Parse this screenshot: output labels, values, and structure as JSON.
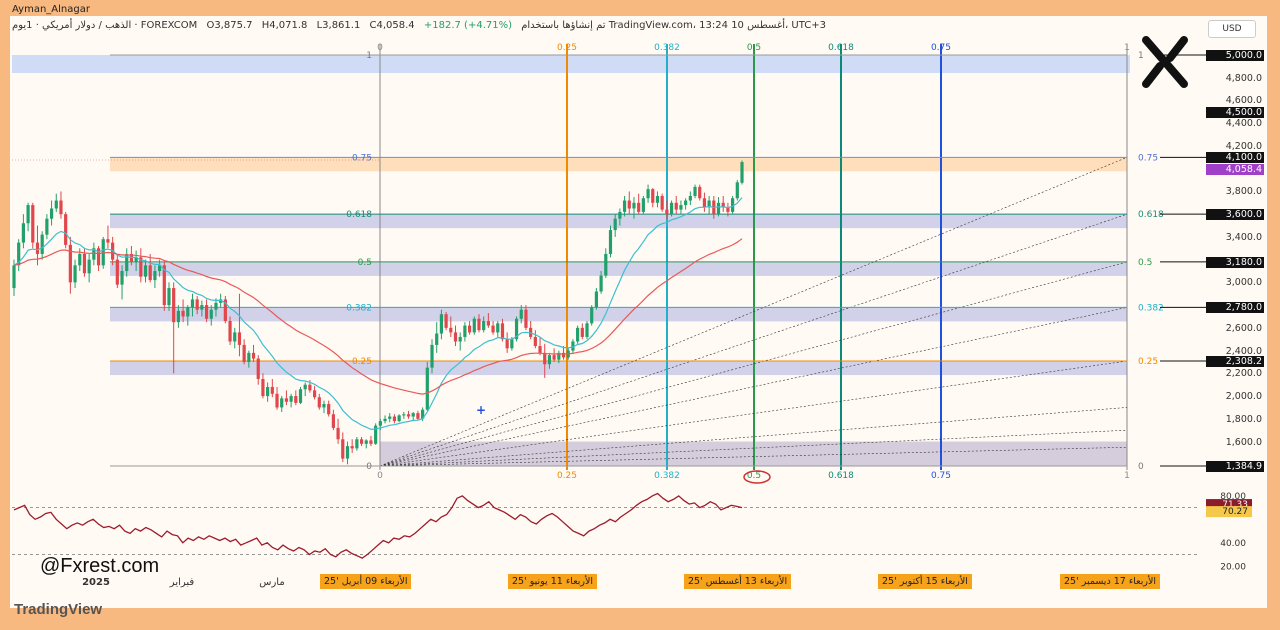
{
  "header": {
    "author": "Ayman_Alnagar",
    "published_text": "تم إنشاؤها باستخدام TradingView.com، 13:24 أغسطس 10، UTC+3",
    "symbol": "الذهب / دولار أمريكي · 1يوم · FOREXCOM",
    "open": "O3,875.7",
    "high": "H4,071.8",
    "low": "L3,861.1",
    "close": "C4,058.4",
    "change": "+182.7 (+4.71%)",
    "currency": "USD"
  },
  "watermark": "@Fxrest.com",
  "logo_text": "TradingView",
  "colors": {
    "up": "#22a06b",
    "down": "#e0464c",
    "ema_fast": "#3cc0d0",
    "ema_slow": "#e85a5a",
    "rsi": "#9c1c2c"
  },
  "chart_data": {
    "type": "candlestick",
    "instrument": "Gold / US Dollar",
    "ylim": [
      1200,
      5200
    ],
    "price_ticks": [
      1600,
      1800,
      2000,
      2200,
      2400,
      2600,
      2800,
      3000,
      3200,
      3400,
      3600,
      3800,
      4000,
      4200,
      4400,
      4600,
      4800
    ],
    "price_ticks_text": [
      "1,600.0",
      "1,800.0",
      "2,000.0",
      "2,200.0",
      "2,400.0",
      "2,600.0",
      "2,800.0",
      "3,000.0",
      "3,200.0",
      "3,400.0",
      "3,600.0",
      "3,800.0",
      "4,000.0",
      "4,200.0",
      "4,400.0",
      "4,600.0",
      "4,800.0"
    ],
    "marked_levels": [
      {
        "value": 5000.0,
        "text": "5,000.0"
      },
      {
        "value": 4500.0,
        "text": "4,500.0"
      },
      {
        "value": 4100.0,
        "text": "4,100.0"
      },
      {
        "value": 3600.0,
        "text": "3,600.0"
      },
      {
        "value": 3180.0,
        "text": "3,180.0"
      },
      {
        "value": 2780.0,
        "text": "2,780.0"
      },
      {
        "value": 2308.2,
        "text": "2,308.2"
      },
      {
        "value": 1384.9,
        "text": "1,384.9"
      }
    ],
    "last_price": {
      "value": 4058.4,
      "text": "4,058.4"
    },
    "fib_levels": [
      {
        "ratio": "0",
        "price": 1384.9
      },
      {
        "ratio": "0.25",
        "price": 2308.2
      },
      {
        "ratio": "0.382",
        "price": 2780.0
      },
      {
        "ratio": "0.5",
        "price": 3180.0
      },
      {
        "ratio": "0.618",
        "price": 3600.0
      },
      {
        "ratio": "0.75",
        "price": 4100.0
      },
      {
        "ratio": "1",
        "price": 5000.0
      }
    ],
    "time_fib_labels": [
      "0",
      "0.25",
      "0.382",
      "0.5",
      "0.618",
      "0.75",
      "1"
    ],
    "right_fib_labels": [
      "0",
      "0.25",
      "0.382",
      "0.5",
      "0.618",
      "0.75",
      "1"
    ],
    "x_axis_labels": [
      "2025",
      "فبراير",
      "مارس",
      "أبريل",
      "يونيو"
    ],
    "date_labels": [
      "الأربعاء 09 أبريل '25",
      "الأربعاء 11 يونيو '25",
      "الأربعاء 13 أغسطس '25",
      "الأربعاء 15 أكتوبر '25",
      "الأربعاء 17 ديسمبر '25"
    ],
    "candles": [
      [
        2950,
        3200,
        2880,
        3150
      ],
      [
        3150,
        3380,
        3100,
        3350
      ],
      [
        3350,
        3600,
        3300,
        3520
      ],
      [
        3520,
        3700,
        3450,
        3680
      ],
      [
        3680,
        3700,
        3300,
        3350
      ],
      [
        3350,
        3500,
        3150,
        3250
      ],
      [
        3250,
        3450,
        3200,
        3420
      ],
      [
        3420,
        3600,
        3380,
        3560
      ],
      [
        3560,
        3720,
        3500,
        3650
      ],
      [
        3650,
        3780,
        3620,
        3720
      ],
      [
        3720,
        3800,
        3560,
        3600
      ],
      [
        3600,
        3620,
        3300,
        3330
      ],
      [
        3330,
        3400,
        2900,
        3000
      ],
      [
        3000,
        3200,
        2950,
        3150
      ],
      [
        3150,
        3300,
        3100,
        3250
      ],
      [
        3250,
        3300,
        3050,
        3080
      ],
      [
        3080,
        3250,
        3000,
        3200
      ],
      [
        3200,
        3350,
        3150,
        3300
      ],
      [
        3300,
        3320,
        3100,
        3150
      ],
      [
        3150,
        3400,
        3120,
        3380
      ],
      [
        3380,
        3500,
        3300,
        3350
      ],
      [
        3350,
        3400,
        3150,
        3200
      ],
      [
        3200,
        3250,
        2950,
        2980
      ],
      [
        2980,
        3150,
        2850,
        3100
      ],
      [
        3100,
        3300,
        3050,
        3250
      ],
      [
        3250,
        3320,
        3150,
        3180
      ],
      [
        3180,
        3280,
        3100,
        3220
      ],
      [
        3220,
        3300,
        3000,
        3050
      ],
      [
        3050,
        3200,
        3000,
        3150
      ],
      [
        3150,
        3250,
        3000,
        3020
      ],
      [
        3020,
        3150,
        2950,
        3100
      ],
      [
        3100,
        3200,
        3050,
        3150
      ],
      [
        3150,
        3180,
        2750,
        2800
      ],
      [
        2800,
        3000,
        2750,
        2950
      ],
      [
        2950,
        3000,
        2200,
        2650
      ],
      [
        2650,
        2800,
        2600,
        2750
      ],
      [
        2750,
        2850,
        2650,
        2700
      ],
      [
        2700,
        2800,
        2620,
        2780
      ],
      [
        2780,
        2900,
        2700,
        2850
      ],
      [
        2850,
        2880,
        2720,
        2760
      ],
      [
        2760,
        2840,
        2700,
        2800
      ],
      [
        2800,
        2850,
        2650,
        2680
      ],
      [
        2680,
        2800,
        2620,
        2760
      ],
      [
        2760,
        2860,
        2700,
        2820
      ],
      [
        2820,
        2900,
        2780,
        2850
      ],
      [
        2850,
        2880,
        2640,
        2660
      ],
      [
        2660,
        2700,
        2450,
        2480
      ],
      [
        2480,
        2600,
        2420,
        2560
      ],
      [
        2560,
        2900,
        2350,
        2450
      ],
      [
        2450,
        2500,
        2280,
        2300
      ],
      [
        2300,
        2400,
        2250,
        2380
      ],
      [
        2380,
        2450,
        2300,
        2330
      ],
      [
        2330,
        2360,
        2100,
        2150
      ],
      [
        2150,
        2200,
        1980,
        2000
      ],
      [
        2000,
        2120,
        1950,
        2080
      ],
      [
        2080,
        2150,
        1990,
        2020
      ],
      [
        2020,
        2080,
        1880,
        1900
      ],
      [
        1900,
        2000,
        1860,
        1980
      ],
      [
        1980,
        2050,
        1920,
        1950
      ],
      [
        1950,
        2020,
        1900,
        2000
      ],
      [
        2000,
        2050,
        1920,
        1940
      ],
      [
        1940,
        2080,
        1930,
        2060
      ],
      [
        2060,
        2120,
        2000,
        2100
      ],
      [
        2100,
        2140,
        2030,
        2050
      ],
      [
        2050,
        2090,
        1970,
        1990
      ],
      [
        1990,
        2020,
        1880,
        1900
      ],
      [
        1900,
        1960,
        1850,
        1930
      ],
      [
        1930,
        1960,
        1820,
        1840
      ],
      [
        1840,
        1880,
        1700,
        1720
      ],
      [
        1720,
        1800,
        1580,
        1620
      ],
      [
        1620,
        1680,
        1420,
        1450
      ],
      [
        1450,
        1600,
        1400,
        1560
      ],
      [
        1560,
        1620,
        1500,
        1540
      ],
      [
        1540,
        1640,
        1520,
        1620
      ],
      [
        1620,
        1640,
        1560,
        1580
      ],
      [
        1580,
        1620,
        1540,
        1610
      ],
      [
        1610,
        1650,
        1560,
        1580
      ],
      [
        1580,
        1760,
        1570,
        1740
      ],
      [
        1740,
        1800,
        1700,
        1780
      ],
      [
        1780,
        1830,
        1760,
        1800
      ],
      [
        1800,
        1850,
        1770,
        1820
      ],
      [
        1820,
        1840,
        1760,
        1780
      ],
      [
        1780,
        1840,
        1770,
        1830
      ],
      [
        1830,
        1860,
        1800,
        1840
      ],
      [
        1840,
        1870,
        1800,
        1820
      ],
      [
        1820,
        1860,
        1780,
        1850
      ],
      [
        1850,
        1870,
        1790,
        1800
      ],
      [
        1800,
        1900,
        1780,
        1880
      ],
      [
        1880,
        2300,
        1870,
        2250
      ],
      [
        2250,
        2500,
        2200,
        2450
      ],
      [
        2450,
        2650,
        2380,
        2550
      ],
      [
        2550,
        2760,
        2500,
        2720
      ],
      [
        2720,
        2740,
        2580,
        2600
      ],
      [
        2600,
        2700,
        2520,
        2560
      ],
      [
        2560,
        2620,
        2440,
        2480
      ],
      [
        2480,
        2560,
        2400,
        2520
      ],
      [
        2520,
        2650,
        2480,
        2620
      ],
      [
        2620,
        2660,
        2540,
        2560
      ],
      [
        2560,
        2700,
        2540,
        2680
      ],
      [
        2680,
        2720,
        2560,
        2580
      ],
      [
        2580,
        2700,
        2560,
        2660
      ],
      [
        2660,
        2730,
        2600,
        2620
      ],
      [
        2620,
        2660,
        2540,
        2560
      ],
      [
        2560,
        2660,
        2520,
        2640
      ],
      [
        2640,
        2680,
        2480,
        2500
      ],
      [
        2500,
        2560,
        2380,
        2420
      ],
      [
        2420,
        2520,
        2400,
        2500
      ],
      [
        2500,
        2700,
        2480,
        2680
      ],
      [
        2680,
        2800,
        2640,
        2760
      ],
      [
        2760,
        2800,
        2580,
        2600
      ],
      [
        2600,
        2660,
        2500,
        2520
      ],
      [
        2520,
        2580,
        2420,
        2440
      ],
      [
        2440,
        2520,
        2360,
        2380
      ],
      [
        2380,
        2460,
        2160,
        2280
      ],
      [
        2280,
        2380,
        2240,
        2360
      ],
      [
        2360,
        2420,
        2300,
        2320
      ],
      [
        2320,
        2400,
        2290,
        2380
      ],
      [
        2380,
        2440,
        2320,
        2340
      ],
      [
        2340,
        2420,
        2320,
        2400
      ],
      [
        2400,
        2500,
        2380,
        2480
      ],
      [
        2480,
        2620,
        2460,
        2600
      ],
      [
        2600,
        2640,
        2500,
        2520
      ],
      [
        2520,
        2660,
        2500,
        2640
      ],
      [
        2640,
        2800,
        2620,
        2780
      ],
      [
        2780,
        2950,
        2760,
        2920
      ],
      [
        2920,
        3100,
        2900,
        3060
      ],
      [
        3060,
        3300,
        3040,
        3250
      ],
      [
        3250,
        3500,
        3220,
        3460
      ],
      [
        3460,
        3600,
        3400,
        3560
      ],
      [
        3560,
        3650,
        3500,
        3620
      ],
      [
        3620,
        3760,
        3580,
        3720
      ],
      [
        3720,
        3800,
        3600,
        3650
      ],
      [
        3650,
        3750,
        3560,
        3700
      ],
      [
        3700,
        3780,
        3600,
        3620
      ],
      [
        3620,
        3760,
        3600,
        3740
      ],
      [
        3740,
        3860,
        3700,
        3820
      ],
      [
        3820,
        3830,
        3660,
        3700
      ],
      [
        3700,
        3800,
        3660,
        3760
      ],
      [
        3760,
        3780,
        3620,
        3640
      ],
      [
        3640,
        3720,
        3560,
        3600
      ],
      [
        3600,
        3720,
        3580,
        3700
      ],
      [
        3700,
        3760,
        3600,
        3640
      ],
      [
        3640,
        3720,
        3600,
        3680
      ],
      [
        3680,
        3740,
        3640,
        3720
      ],
      [
        3720,
        3800,
        3680,
        3760
      ],
      [
        3760,
        3860,
        3740,
        3840
      ],
      [
        3840,
        3860,
        3720,
        3740
      ],
      [
        3740,
        3790,
        3620,
        3660
      ],
      [
        3660,
        3760,
        3600,
        3720
      ],
      [
        3720,
        3760,
        3560,
        3600
      ],
      [
        3600,
        3750,
        3580,
        3700
      ],
      [
        3700,
        3760,
        3620,
        3660
      ],
      [
        3660,
        3700,
        3580,
        3620
      ],
      [
        3620,
        3760,
        3600,
        3740
      ],
      [
        3740,
        3900,
        3720,
        3880
      ],
      [
        3876,
        4072,
        3861,
        4058
      ]
    ],
    "rsi": {
      "last_values": [
        "71.33",
        "70.27"
      ],
      "ticks": [
        "80.00",
        "40.00",
        "20.00"
      ],
      "levels": [
        70,
        30
      ],
      "values": [
        68,
        70,
        72,
        64,
        60,
        62,
        65,
        66,
        60,
        56,
        52,
        55,
        57,
        55,
        58,
        60,
        56,
        53,
        54,
        52,
        55,
        50,
        48,
        52,
        50,
        53,
        51,
        48,
        45,
        50,
        47,
        46,
        40,
        44,
        42,
        45,
        43,
        46,
        44,
        42,
        44,
        41,
        43,
        38,
        40,
        42,
        44,
        38,
        40,
        36,
        34,
        38,
        35,
        33,
        36,
        34,
        30,
        33,
        32,
        35,
        30,
        28,
        32,
        34,
        31,
        29,
        27,
        30,
        34,
        38,
        42,
        40,
        44,
        43,
        46,
        45,
        48,
        52,
        56,
        60,
        58,
        62,
        64,
        70,
        78,
        80,
        76,
        73,
        70,
        72,
        75,
        70,
        68,
        66,
        63,
        60,
        64,
        62,
        58,
        56,
        60,
        63,
        65,
        62,
        58,
        54,
        50,
        48,
        46,
        50,
        52,
        55,
        57,
        60,
        58,
        62,
        65,
        68,
        72,
        75,
        77,
        80,
        82,
        78,
        75,
        77,
        80,
        76,
        73,
        74,
        70,
        72,
        75,
        73,
        68,
        70,
        72,
        71,
        70
      ]
    }
  }
}
